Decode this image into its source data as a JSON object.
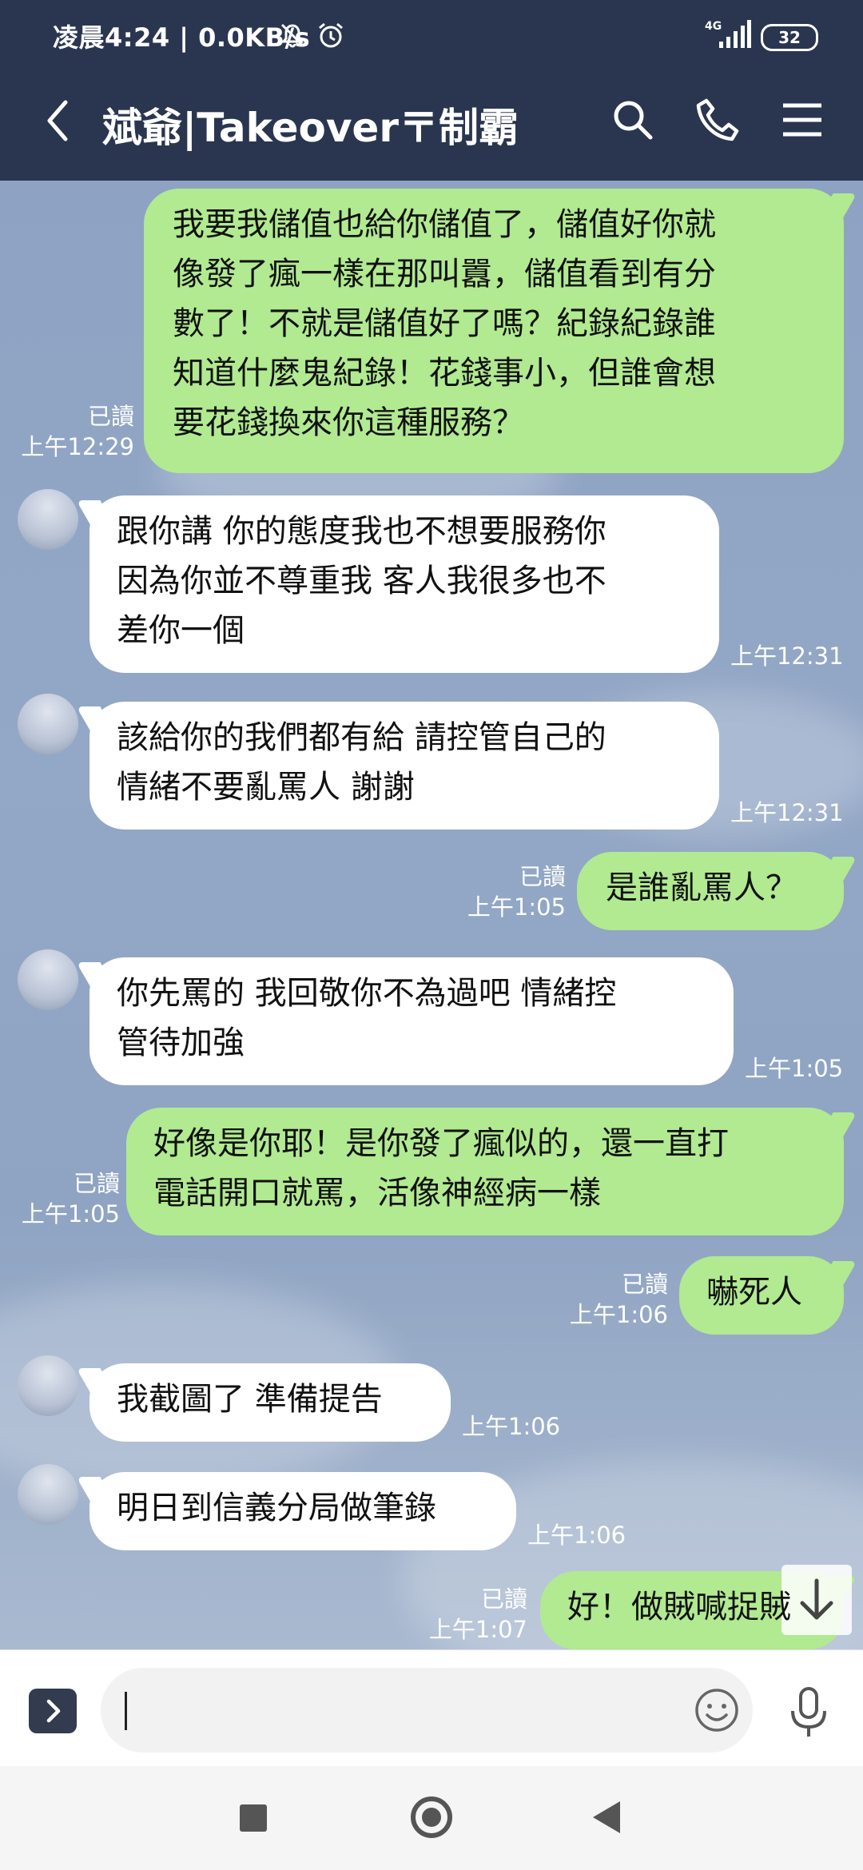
{
  "status_bar": {
    "time": "凌晨4:24",
    "speed": "0.0KB/s",
    "network": "4G",
    "battery": "32"
  },
  "header": {
    "title": "斌爺|Takeover〒制霸"
  },
  "messages": [
    {
      "dir": "out",
      "read": "已讀",
      "time": "上午12:29",
      "lines": [
        "我要我儲值也給你儲值了，儲值好你就",
        "像發了瘋一樣在那叫囂，儲值看到有分",
        "數了！不就是儲值好了嗎？紀錄紀錄誰",
        "知道什麼鬼紀錄！花錢事小，但誰會想",
        "要花錢換來你這種服務？"
      ]
    },
    {
      "dir": "in",
      "time": "上午12:31",
      "lines": [
        "跟你講 你的態度我也不想要服務你",
        "因為你並不尊重我 客人我很多也不",
        "差你一個"
      ]
    },
    {
      "dir": "in",
      "time": "上午12:31",
      "lines": [
        "該給你的我們都有給 請控管自己的",
        "情緒不要亂罵人 謝謝"
      ]
    },
    {
      "dir": "out",
      "read": "已讀",
      "time": "上午1:05",
      "lines": [
        "是誰亂罵人？"
      ]
    },
    {
      "dir": "in",
      "time": "上午1:05",
      "lines": [
        "你先罵的 我回敬你不為過吧 情緒控",
        "管待加強"
      ]
    },
    {
      "dir": "out",
      "read": "已讀",
      "time": "上午1:05",
      "lines": [
        "好像是你耶！是你發了瘋似的，還一直打",
        "電話開口就罵，活像神經病一樣"
      ]
    },
    {
      "dir": "out",
      "read": "已讀",
      "time": "上午1:06",
      "lines": [
        "嚇死人"
      ]
    },
    {
      "dir": "in",
      "time": "上午1:06",
      "lines": [
        "我截圖了 準備提告"
      ]
    },
    {
      "dir": "in",
      "time": "上午1:06",
      "lines": [
        "明日到信義分局做筆錄"
      ]
    },
    {
      "dir": "out",
      "read": "已讀",
      "time": "上午1:07",
      "lines": [
        "好！做賊喊捉賊"
      ]
    }
  ],
  "colors": {
    "header_bg": "#2a3650",
    "outgoing_bubble": "#b1ea90",
    "incoming_bubble": "#ffffff",
    "chat_bg": "#8fa4c4"
  },
  "icons": {
    "back": "chevron-left-icon",
    "search": "search-icon",
    "call": "phone-icon",
    "menu": "menu-icon",
    "expand": "chevron-right-icon",
    "emoji": "smiley-icon",
    "mic": "microphone-icon",
    "scroll_down": "arrow-down-icon"
  }
}
